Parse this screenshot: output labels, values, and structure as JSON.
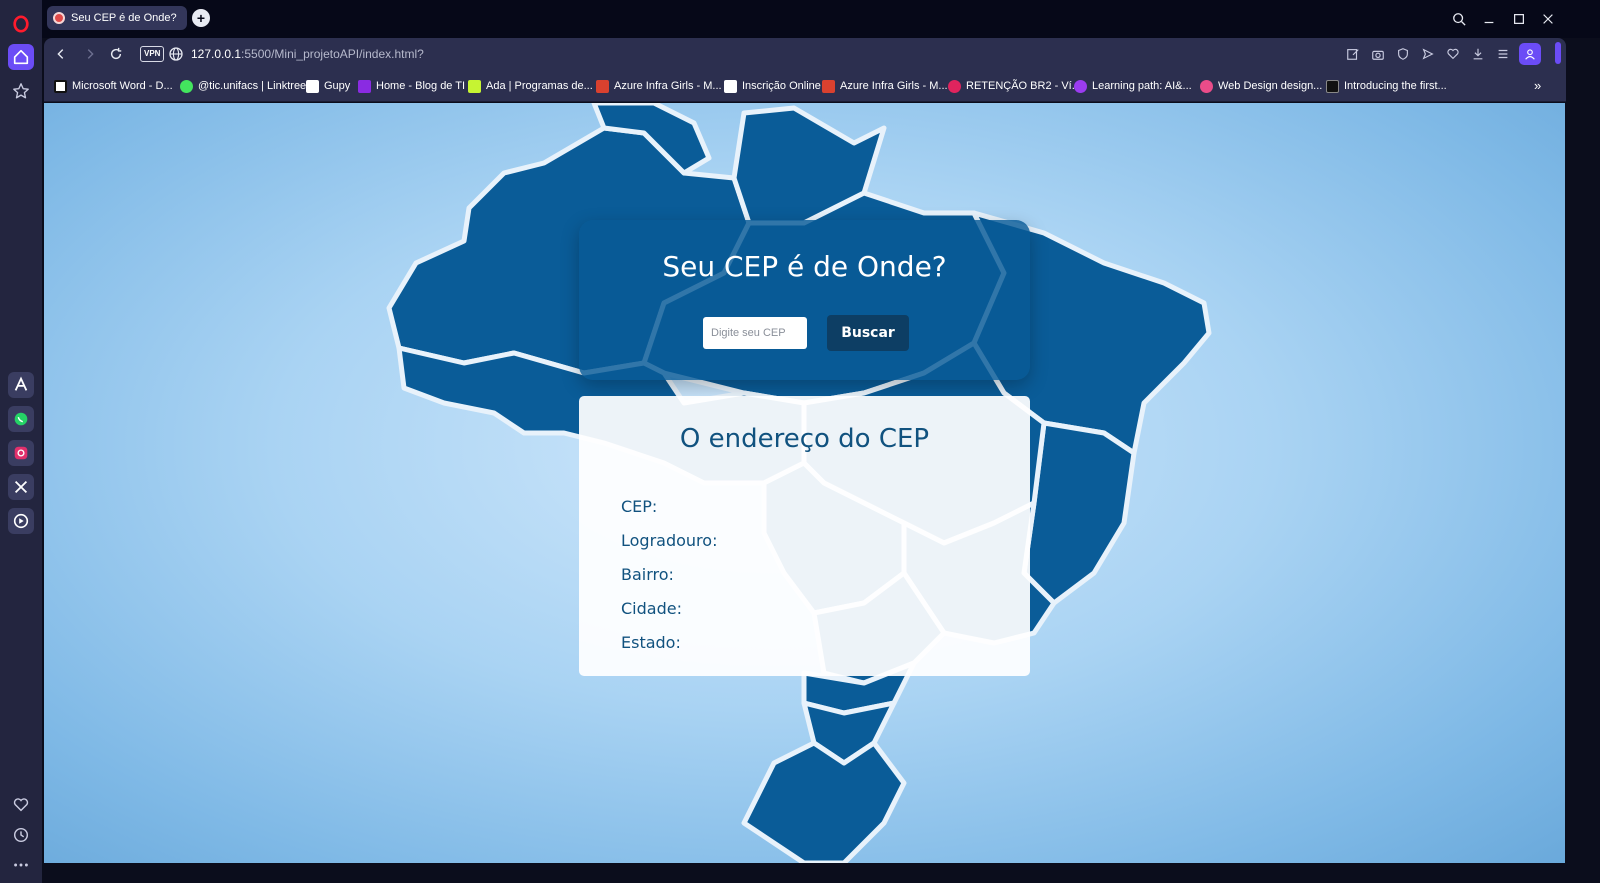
{
  "browser": {
    "tab": {
      "title": "Seu CEP é de Onde?"
    },
    "new_tab_label": "+",
    "address": {
      "vpn_label": "VPN",
      "url_host": "127.0.0.1",
      "url_rest": ":5500/Mini_projetoAPI/index.html?"
    },
    "bookmarks": [
      {
        "label": "Microsoft Word - D...",
        "icon": "notion-icon",
        "color": "#ffffff"
      },
      {
        "label": "@tic.unifacs | Linktree",
        "icon": "linktree-icon",
        "color": "#43e55e"
      },
      {
        "label": "Gupy",
        "icon": "gupy-icon",
        "color": "#ffffff"
      },
      {
        "label": "Home - Blog de TI",
        "icon": "blog-icon",
        "color": "#8a2be2"
      },
      {
        "label": "Ada | Programas de...",
        "icon": "ada-icon",
        "color": "#c6f432"
      },
      {
        "label": "Azure Infra Girls - M...",
        "icon": "azure-icon",
        "color": "#d9412f"
      },
      {
        "label": "Inscrição Online",
        "icon": "document-icon",
        "color": "#ffffff"
      },
      {
        "label": "Azure Infra Girls - M...",
        "icon": "azure-icon",
        "color": "#d9412f"
      },
      {
        "label": "RETENÇÃO BR2 - Ví...",
        "icon": "retencao-icon",
        "color": "#e0245e"
      },
      {
        "label": "Learning path: AI&...",
        "icon": "learning-icon",
        "color": "#9b3cf0"
      },
      {
        "label": "Web Design design...",
        "icon": "dribbble-icon",
        "color": "#ea4c89"
      },
      {
        "label": "Introducing the first...",
        "icon": "medium-icon",
        "color": "#111111"
      }
    ],
    "more_label": "»"
  },
  "page": {
    "hero_title": "Seu CEP é de Onde?",
    "cep_placeholder": "Digite seu CEP",
    "search_button": "Buscar",
    "result_title": "O endereço do CEP",
    "fields": {
      "cep": "CEP:",
      "logradouro": "Logradouro:",
      "bairro": "Bairro:",
      "cidade": "Cidade:",
      "estado": "Estado:"
    }
  },
  "colors": {
    "accent": "#6b4cf6",
    "map_blue": "#0a5c98",
    "text_blue": "#11527f",
    "button_blue": "#0d3e64"
  }
}
